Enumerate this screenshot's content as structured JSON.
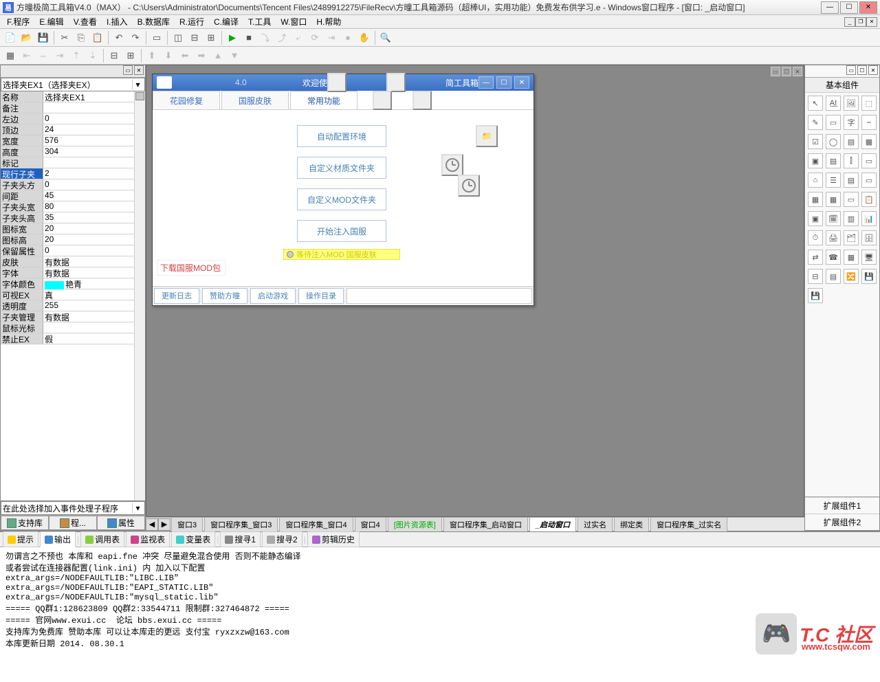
{
  "window": {
    "title": "方曈极简工具箱V4.0（MAX）  -  C:\\Users\\Administrator\\Documents\\Tencent Files\\2489912275\\FileRecv\\方曈工具箱源码（超棒UI，实用功能）免费发布供学习.e - Windows窗口程序 - [窗口: _启动窗口]"
  },
  "menu": {
    "items": [
      "F.程序",
      "E.编辑",
      "V.查看",
      "I.插入",
      "B.数据库",
      "R.运行",
      "C.编译",
      "T.工具",
      "W.窗口",
      "H.帮助"
    ]
  },
  "toolbar1": {
    "icons": [
      "new",
      "open",
      "save",
      "sep",
      "cut",
      "copy",
      "paste",
      "sep",
      "undo",
      "redo",
      "sep",
      "form",
      "sep",
      "win1",
      "win2",
      "win3",
      "sep",
      "run",
      "stop",
      "step-into",
      "step-over",
      "step-out",
      "step-run",
      "step-cursor",
      "breakpoint",
      "hand",
      "sep",
      "find"
    ]
  },
  "toolbar2": {
    "icons": [
      "grid",
      "align-left",
      "align-right",
      "align-top",
      "align-bottom",
      "sep",
      "layout1",
      "layout2",
      "sep",
      "move-up",
      "move-down",
      "move-left",
      "move-front",
      "move-back",
      "move-right"
    ]
  },
  "leftpanel": {
    "selector": "选择夹EX1（选择夹EX）",
    "eventcombo": "在此处选择加入事件处理子程序",
    "props": [
      {
        "name": "名称",
        "val": "选择夹EX1"
      },
      {
        "name": "备注",
        "val": ""
      },
      {
        "name": "左边",
        "val": "0"
      },
      {
        "name": "顶边",
        "val": "24"
      },
      {
        "name": "宽度",
        "val": "576"
      },
      {
        "name": "高度",
        "val": "304"
      },
      {
        "name": "标记",
        "val": ""
      },
      {
        "name": "现行子夹",
        "val": "2",
        "sel": true
      },
      {
        "name": "子夹头方向",
        "val": "0"
      },
      {
        "name": "间距",
        "val": "45"
      },
      {
        "name": "子夹头宽度",
        "val": "80"
      },
      {
        "name": "子夹头高度",
        "val": "35"
      },
      {
        "name": "图标宽",
        "val": "20"
      },
      {
        "name": "图标高",
        "val": "20"
      },
      {
        "name": "保留属性",
        "val": "0"
      },
      {
        "name": "皮肤",
        "val": "有数据"
      },
      {
        "name": "字体",
        "val": "有数据"
      },
      {
        "name": "字体颜色",
        "val": "艳青",
        "color": true
      },
      {
        "name": "可视EX",
        "val": "真"
      },
      {
        "name": "透明度",
        "val": "255"
      },
      {
        "name": "子夹管理",
        "val": "有数据"
      },
      {
        "name": "鼠标光标",
        "val": ""
      },
      {
        "name": "禁止EX",
        "val": "假"
      }
    ],
    "buttons": {
      "lib": "支持库",
      "prog": "程...",
      "prop": "属性"
    }
  },
  "designer": {
    "form_title_prefix": "欢迎使用",
    "form_title_suffix": "简工具箱",
    "ver": "4.0",
    "tabs": [
      "花园修复",
      "国服皮肤",
      "常用功能"
    ],
    "buttons": {
      "b1": "自动配置环境",
      "b2": "自定义材质文件夹",
      "b3": "自定义MOD文件夹",
      "b4": "开始注入国服"
    },
    "yellow": "等待注入MOD 国服皮肤",
    "redlink": "下载国服MOD包",
    "bottomtabs": [
      "更新日志",
      "赞助方曈",
      "启动游戏",
      "操作目录"
    ]
  },
  "doctabs": {
    "tabs": [
      {
        "label": "窗口3"
      },
      {
        "label": "窗口程序集_窗口3"
      },
      {
        "label": "窗口程序集_窗口4"
      },
      {
        "label": "窗口4"
      },
      {
        "label": "[图片资源表]",
        "green": true
      },
      {
        "label": "窗口程序集_启动窗口"
      },
      {
        "label": "_启动窗口",
        "active": true,
        "bold": true
      },
      {
        "label": "过实名"
      },
      {
        "label": "绑定类"
      },
      {
        "label": "窗口程序集_过实名"
      }
    ]
  },
  "rightpanel": {
    "title": "基本组件",
    "ext1": "扩展组件1",
    "ext2": "扩展组件2",
    "components": [
      "↖",
      "A̲I̲",
      "🖼",
      "⬚",
      "✎",
      "▭",
      "字",
      "⎯",
      "☑",
      "◯",
      "▤",
      "▦",
      "▣",
      "▤",
      "⫿",
      "▭",
      "⌂",
      "☰",
      "▤",
      "▭",
      "▦",
      "▦",
      "▭",
      "📋",
      "▣",
      "🗓",
      "▥",
      "📊",
      "⏱",
      "🖨",
      "🗂",
      "🗄",
      "⇄",
      "☎",
      "▦",
      "🖥",
      "⊟",
      "▤",
      "🔀",
      "💾",
      "💾"
    ]
  },
  "output": {
    "tabs": [
      "提示",
      "输出",
      "调用表",
      "监视表",
      "变量表",
      "搜寻1",
      "搜寻2",
      "剪辑历史"
    ],
    "text": "勿谓言之不预也 本库和 eapi.fne 冲突 尽量避免混合使用 否则不能静态编译\n或者尝试在连接器配置(link.ini) 内 加入以下配置\nextra_args=/NODEFAULTLIB:\"LIBC.LIB\"\nextra_args=/NODEFAULTLIB:\"EAPI_STATIC.LIB\"\nextra_args=/NODEFAULTLIB:\"mysql_static.lib\"\n===== QQ群1:128623809 QQ群2:33544711 限制群:327464872 =====\n===== 官网www.exui.cc  论坛 bbs.exui.cc =====\n支持库为免费库 赞助本库 可以让本库走的更远 支付宝 ryxzxzw@163.com\n本库更新日期 2014. 08.30.1"
  },
  "watermark": {
    "txt": "T.C 社区",
    "url": "www.tcsqw.com"
  }
}
